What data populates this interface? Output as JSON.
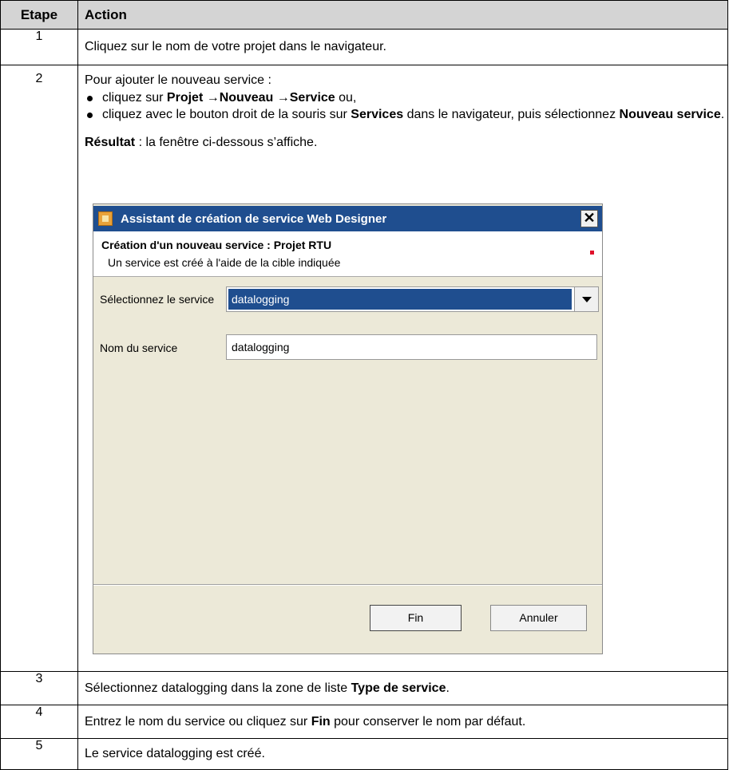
{
  "table": {
    "col_step": "Etape",
    "col_action": "Action",
    "rows": [
      {
        "step": "1",
        "text": "Cliquez sur le nom de votre projet dans le navigateur."
      },
      {
        "step": "2",
        "intro": "Pour ajouter le nouveau service :",
        "bullet1": {
          "pre": "cliquez sur ",
          "b1": "Projet",
          "arrow1": " →",
          "b2": "Nouveau",
          "arrow2": " →",
          "b3": "Service",
          "post": " ou,"
        },
        "bullet2": {
          "pre": "cliquez avec le bouton droit de la souris sur ",
          "b1": "Services",
          "mid": " dans le navigateur, puis sélectionnez ",
          "b2": "Nouveau service",
          "post": "."
        },
        "result_label": "Résultat",
        "result_text": " : la fenêtre ci-dessous s’affiche."
      },
      {
        "step": "3",
        "pre": "Sélectionnez datalogging dans la zone de liste ",
        "bold": "Type de service",
        "post": "."
      },
      {
        "step": "4",
        "pre": "Entrez le nom du service ou cliquez sur ",
        "bold": "Fin",
        "post": " pour conserver le nom par défaut."
      },
      {
        "step": "5",
        "text": "Le service datalogging est créé."
      }
    ]
  },
  "dialog": {
    "title": "Assistant de création de service Web Designer",
    "header_title": "Création d'un nouveau service : Projet RTU",
    "header_subtitle": "Un service est créé à l'aide de la cible indiquée",
    "select_label": "Sélectionnez le service",
    "select_value": "datalogging",
    "name_label": "Nom du service",
    "name_value": "datalogging",
    "finish_button": "Fin",
    "cancel_button": "Annuler",
    "icons": [
      "app-icon",
      "close-icon",
      "dropdown-arrow-icon"
    ],
    "colors": {
      "title_bar": "#1f4e8f",
      "header_bg": "#d4d4d4",
      "dialog_bg": "#ece9d8"
    }
  }
}
